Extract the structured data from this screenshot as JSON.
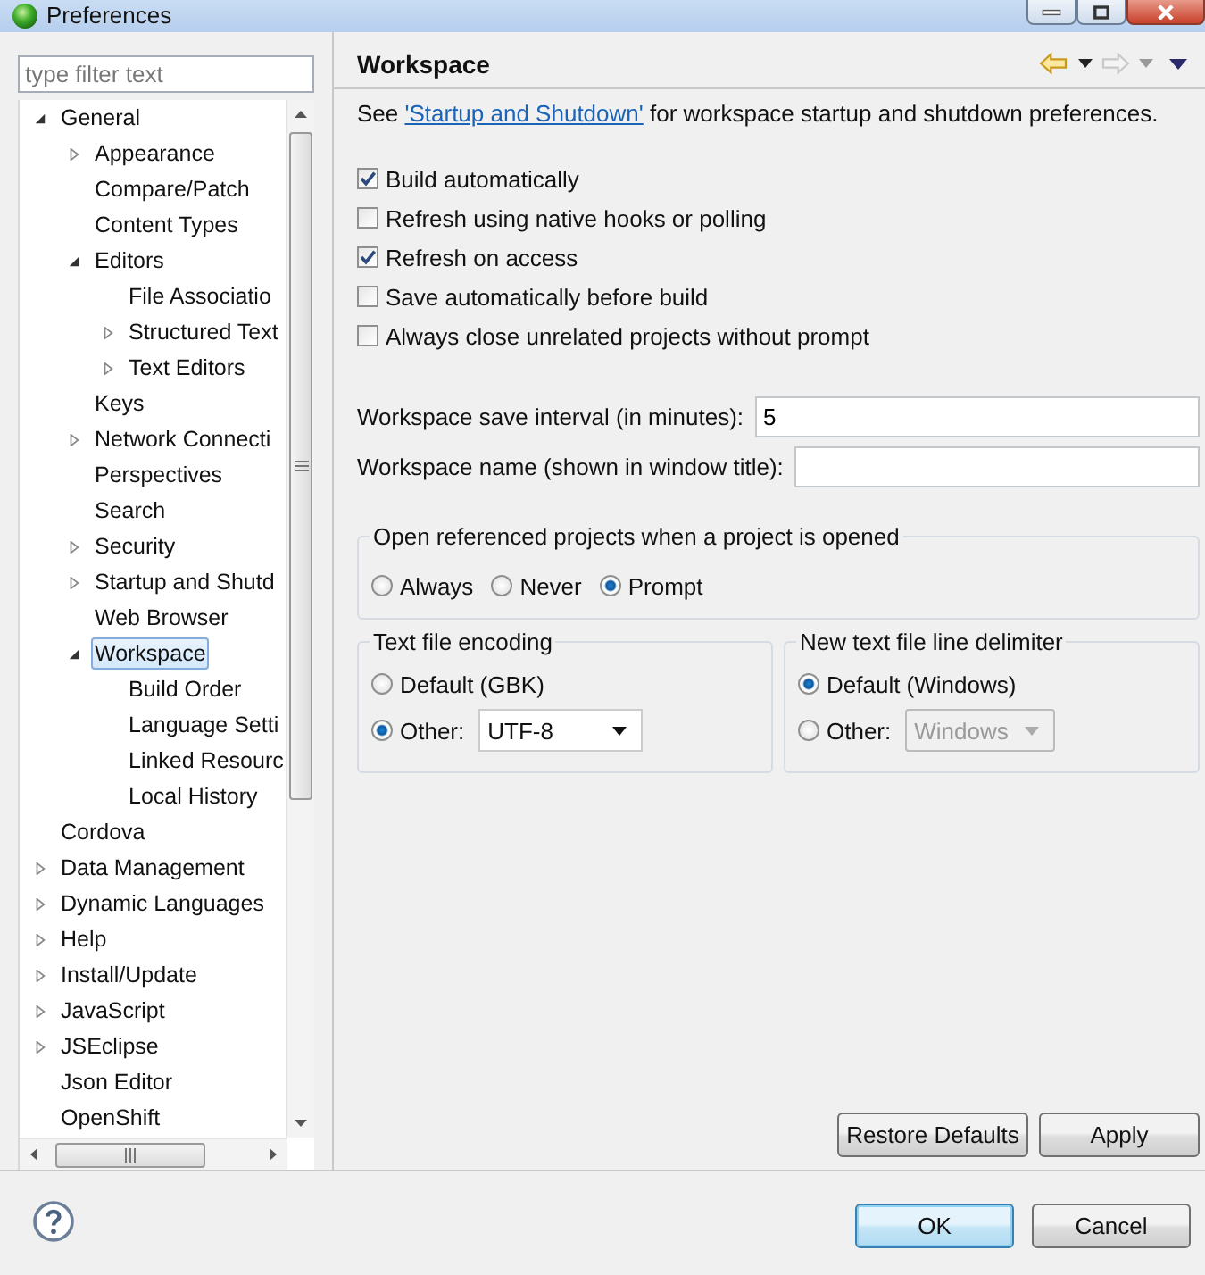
{
  "window": {
    "title": "Preferences"
  },
  "filter": {
    "placeholder": "type filter text"
  },
  "tree": [
    {
      "label": "General",
      "expanded": true,
      "selected": false,
      "children": [
        {
          "label": "Appearance",
          "expanded": false,
          "selected": false
        },
        {
          "label": "Compare/Patch",
          "selected": false
        },
        {
          "label": "Content Types",
          "selected": false
        },
        {
          "label": "Editors",
          "expanded": true,
          "selected": false,
          "children": [
            {
              "label": "File Associatio",
              "selected": false
            },
            {
              "label": "Structured Text",
              "expanded": false,
              "selected": false
            },
            {
              "label": "Text Editors",
              "expanded": false,
              "selected": false
            }
          ]
        },
        {
          "label": "Keys",
          "selected": false
        },
        {
          "label": "Network Connecti",
          "expanded": false,
          "selected": false
        },
        {
          "label": "Perspectives",
          "selected": false
        },
        {
          "label": "Search",
          "selected": false
        },
        {
          "label": "Security",
          "expanded": false,
          "selected": false
        },
        {
          "label": "Startup and Shutd",
          "expanded": false,
          "selected": false
        },
        {
          "label": "Web Browser",
          "selected": false
        },
        {
          "label": "Workspace",
          "expanded": true,
          "selected": true,
          "children": [
            {
              "label": "Build Order",
              "selected": false
            },
            {
              "label": "Language Setti",
              "selected": false
            },
            {
              "label": "Linked Resourc",
              "selected": false
            },
            {
              "label": "Local History",
              "selected": false
            }
          ]
        }
      ]
    },
    {
      "label": "Cordova",
      "selected": false
    },
    {
      "label": "Data Management",
      "expanded": false,
      "selected": false
    },
    {
      "label": "Dynamic Languages",
      "expanded": false,
      "selected": false
    },
    {
      "label": "Help",
      "expanded": false,
      "selected": false
    },
    {
      "label": "Install/Update",
      "expanded": false,
      "selected": false
    },
    {
      "label": "JavaScript",
      "expanded": false,
      "selected": false
    },
    {
      "label": "JSEclipse",
      "expanded": false,
      "selected": false
    },
    {
      "label": "Json Editor",
      "selected": false
    },
    {
      "label": "OpenShift",
      "selected": false
    }
  ],
  "page": {
    "title": "Workspace",
    "intro_before": "See ",
    "intro_link": "'Startup and Shutdown'",
    "intro_after": " for workspace startup and shutdown preferences."
  },
  "checkboxes": [
    {
      "label": "Build automatically",
      "checked": true
    },
    {
      "label": "Refresh using native hooks or polling",
      "checked": false
    },
    {
      "label": "Refresh on access",
      "checked": true
    },
    {
      "label": "Save automatically before build",
      "checked": false
    },
    {
      "label": "Always close unrelated projects without prompt",
      "checked": false
    }
  ],
  "fields": [
    {
      "label": "Workspace save interval (in minutes):",
      "value": "5"
    },
    {
      "label": "Workspace name (shown in window title):"
    }
  ],
  "open_referenced": {
    "title": "Open referenced projects when a project is opened",
    "options": [
      {
        "label": "Always",
        "selected": false
      },
      {
        "label": "Never",
        "selected": false
      },
      {
        "label": "Prompt",
        "selected": true
      }
    ]
  },
  "encoding": {
    "title": "Text file encoding",
    "options": [
      {
        "label": "Default (GBK)",
        "selected": false
      },
      {
        "label": "Other:",
        "selected": true,
        "combo": {
          "value": "UTF-8",
          "disabled": false
        }
      }
    ]
  },
  "line_delimiter": {
    "title": "New text file line delimiter",
    "options": [
      {
        "label": "Default (Windows)",
        "selected": true
      },
      {
        "label": "Other:",
        "selected": false,
        "combo": {
          "value": "Windows",
          "disabled": true
        }
      }
    ]
  },
  "page_buttons": [
    "Restore Defaults",
    "Apply"
  ],
  "dialog_buttons": [
    {
      "label": "OK",
      "default": true
    },
    {
      "label": "Cancel",
      "default": false
    }
  ]
}
